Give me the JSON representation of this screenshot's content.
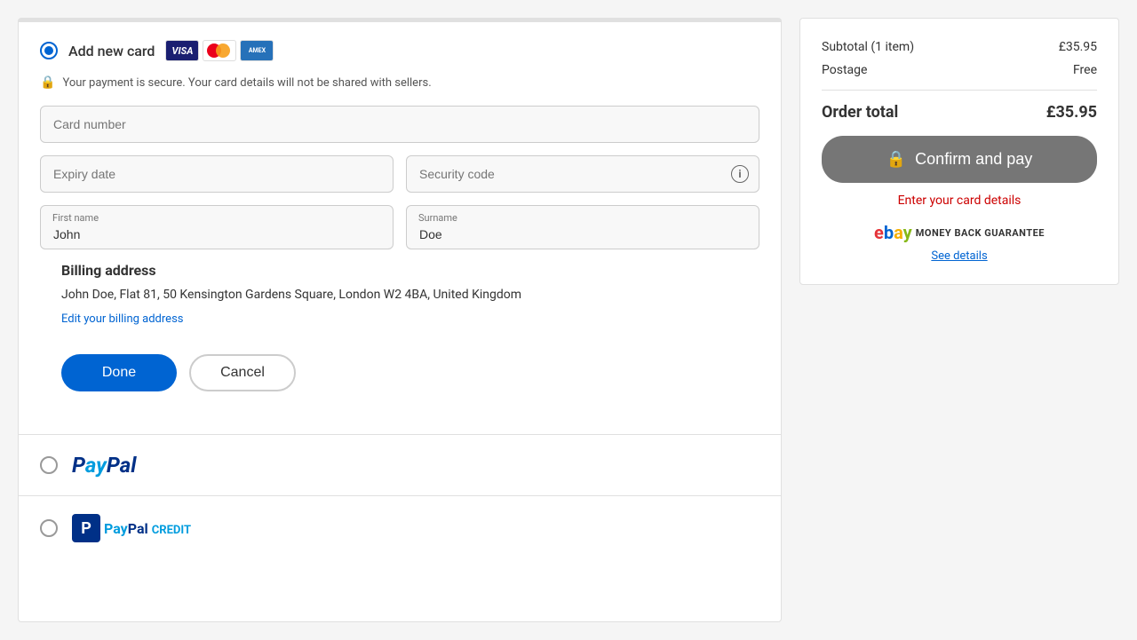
{
  "left": {
    "add_card_label": "Add new card",
    "secure_notice": "Your payment is secure. Your card details will not be shared with sellers.",
    "card_number_placeholder": "Card number",
    "expiry_placeholder": "Expiry date",
    "security_code_placeholder": "Security code",
    "first_name_label": "First name",
    "first_name_value": "John",
    "surname_label": "Surname",
    "surname_value": "Doe",
    "billing_title": "Billing address",
    "billing_address": "John Doe, Flat 81, 50 Kensington Gardens Square, London W2 4BA, United Kingdom",
    "edit_link": "Edit your billing address",
    "done_btn": "Done",
    "cancel_btn": "Cancel",
    "paypal_option": "PayPal"
  },
  "right": {
    "subtotal_label": "Subtotal (1 item)",
    "subtotal_value": "£35.95",
    "postage_label": "Postage",
    "postage_value": "Free",
    "order_total_label": "Order total",
    "order_total_value": "£35.95",
    "confirm_btn": "Confirm and pay",
    "enter_card_msg": "Enter your card details",
    "mbg_text": "MONEY BACK GUARANTEE",
    "see_details": "See details"
  },
  "icons": {
    "lock": "🔒",
    "info": "i"
  }
}
